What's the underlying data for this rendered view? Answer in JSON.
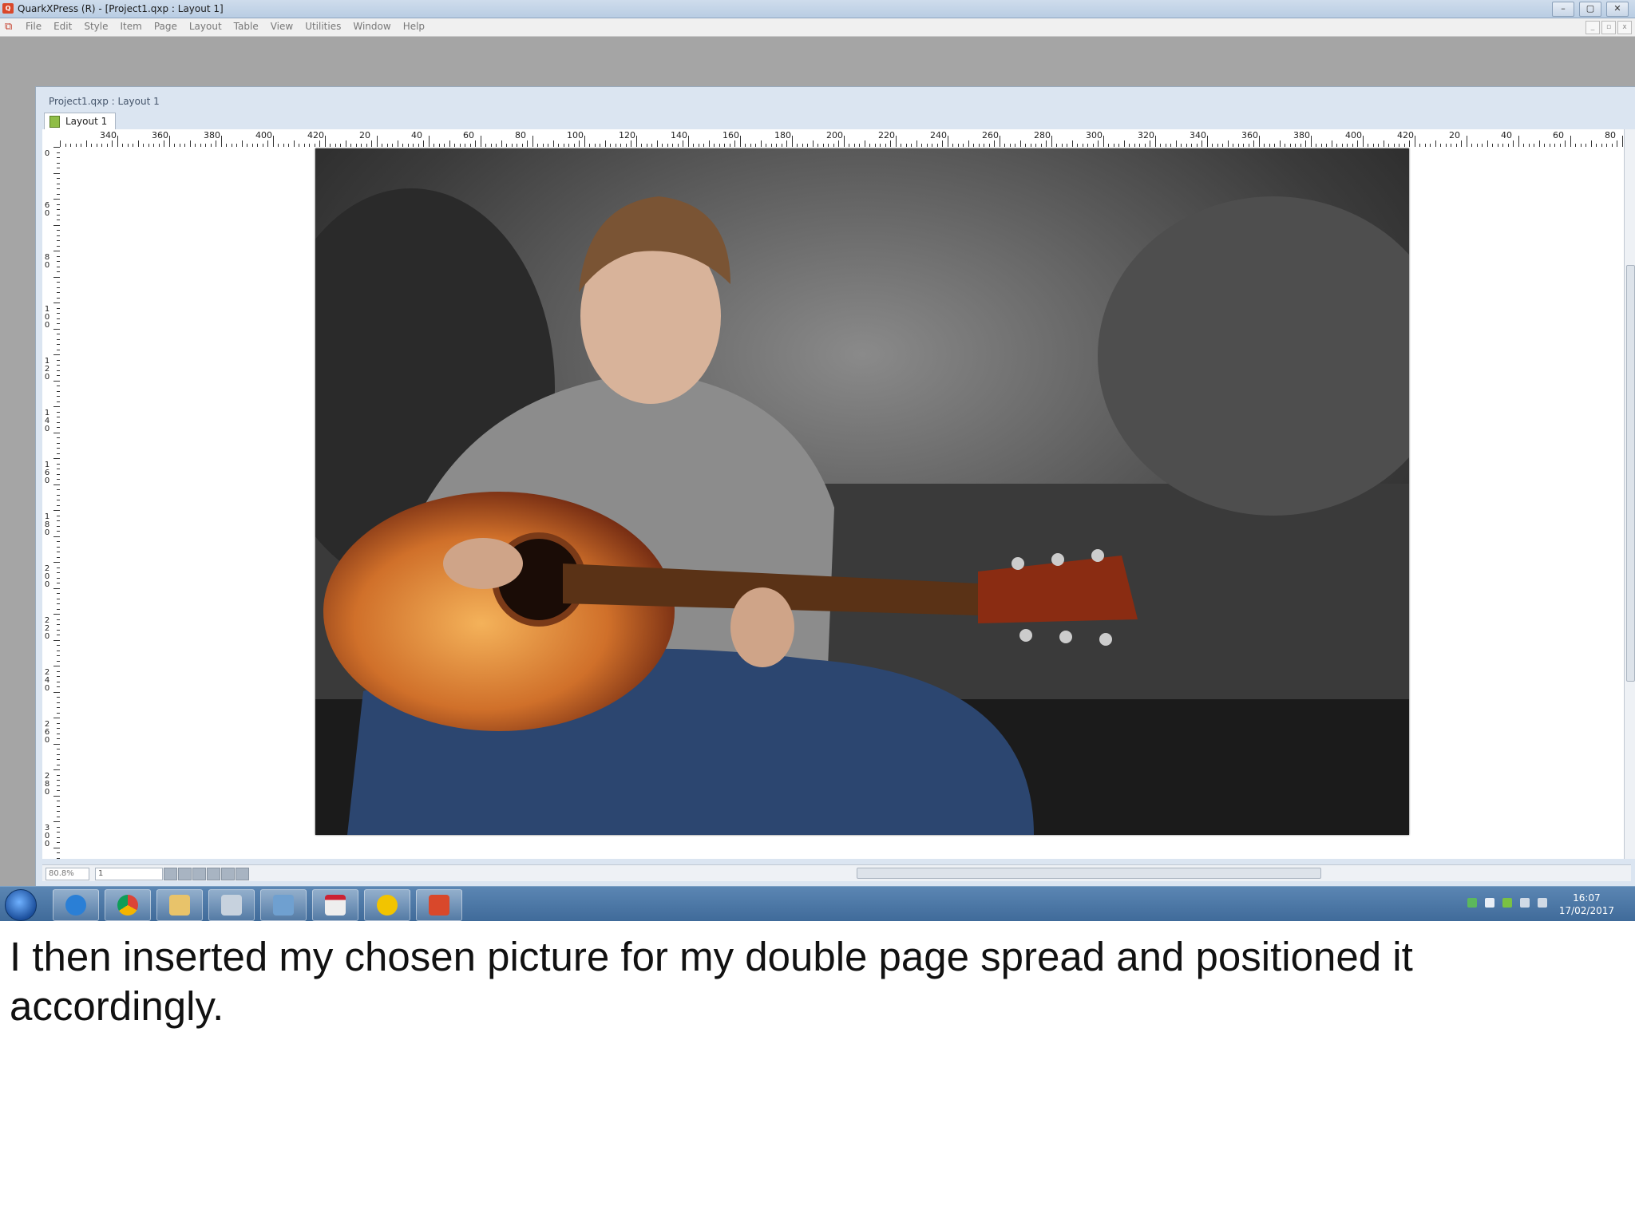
{
  "window": {
    "title": "QuarkXPress (R) - [Project1.qxp : Layout 1]",
    "controls": [
      "–",
      "▢",
      "✕"
    ]
  },
  "menu": {
    "items": [
      "File",
      "Edit",
      "Style",
      "Item",
      "Page",
      "Layout",
      "Table",
      "View",
      "Utilities",
      "Window",
      "Help"
    ]
  },
  "document": {
    "caption": "Project1.qxp : Layout 1",
    "tab_label": "Layout 1",
    "ruler_h_labels": [
      "340",
      "360",
      "380",
      "400",
      "420",
      "20",
      "40",
      "60",
      "80",
      "100",
      "120",
      "140",
      "160",
      "180",
      "200",
      "220",
      "240",
      "260",
      "280",
      "300",
      "320",
      "340",
      "360",
      "380",
      "400",
      "420",
      "20",
      "40",
      "60",
      "80"
    ],
    "ruler_v_labels": [
      "0",
      "60",
      "80",
      "100",
      "120",
      "140",
      "160",
      "180",
      "200",
      "220",
      "240",
      "260",
      "280",
      "300"
    ],
    "zoom": "80.8%",
    "page": "1"
  },
  "photo": {
    "description_icon": "image-icon"
  },
  "taskbar": {
    "time": "16:07",
    "date": "17/02/2017",
    "apps": [
      "internet-explorer-icon",
      "chrome-icon",
      "file-explorer-icon",
      "snipping-tool-icon",
      "window-app-icon",
      "calendar-icon",
      "badge-app-icon",
      "quarkxpress-icon"
    ]
  },
  "caption": "I then inserted my chosen picture for my double page spread and positioned it accordingly.",
  "colors": {
    "taskbar": "#4a76a5",
    "workspace": "#a5a5a5",
    "quark_red": "#d9482b"
  }
}
